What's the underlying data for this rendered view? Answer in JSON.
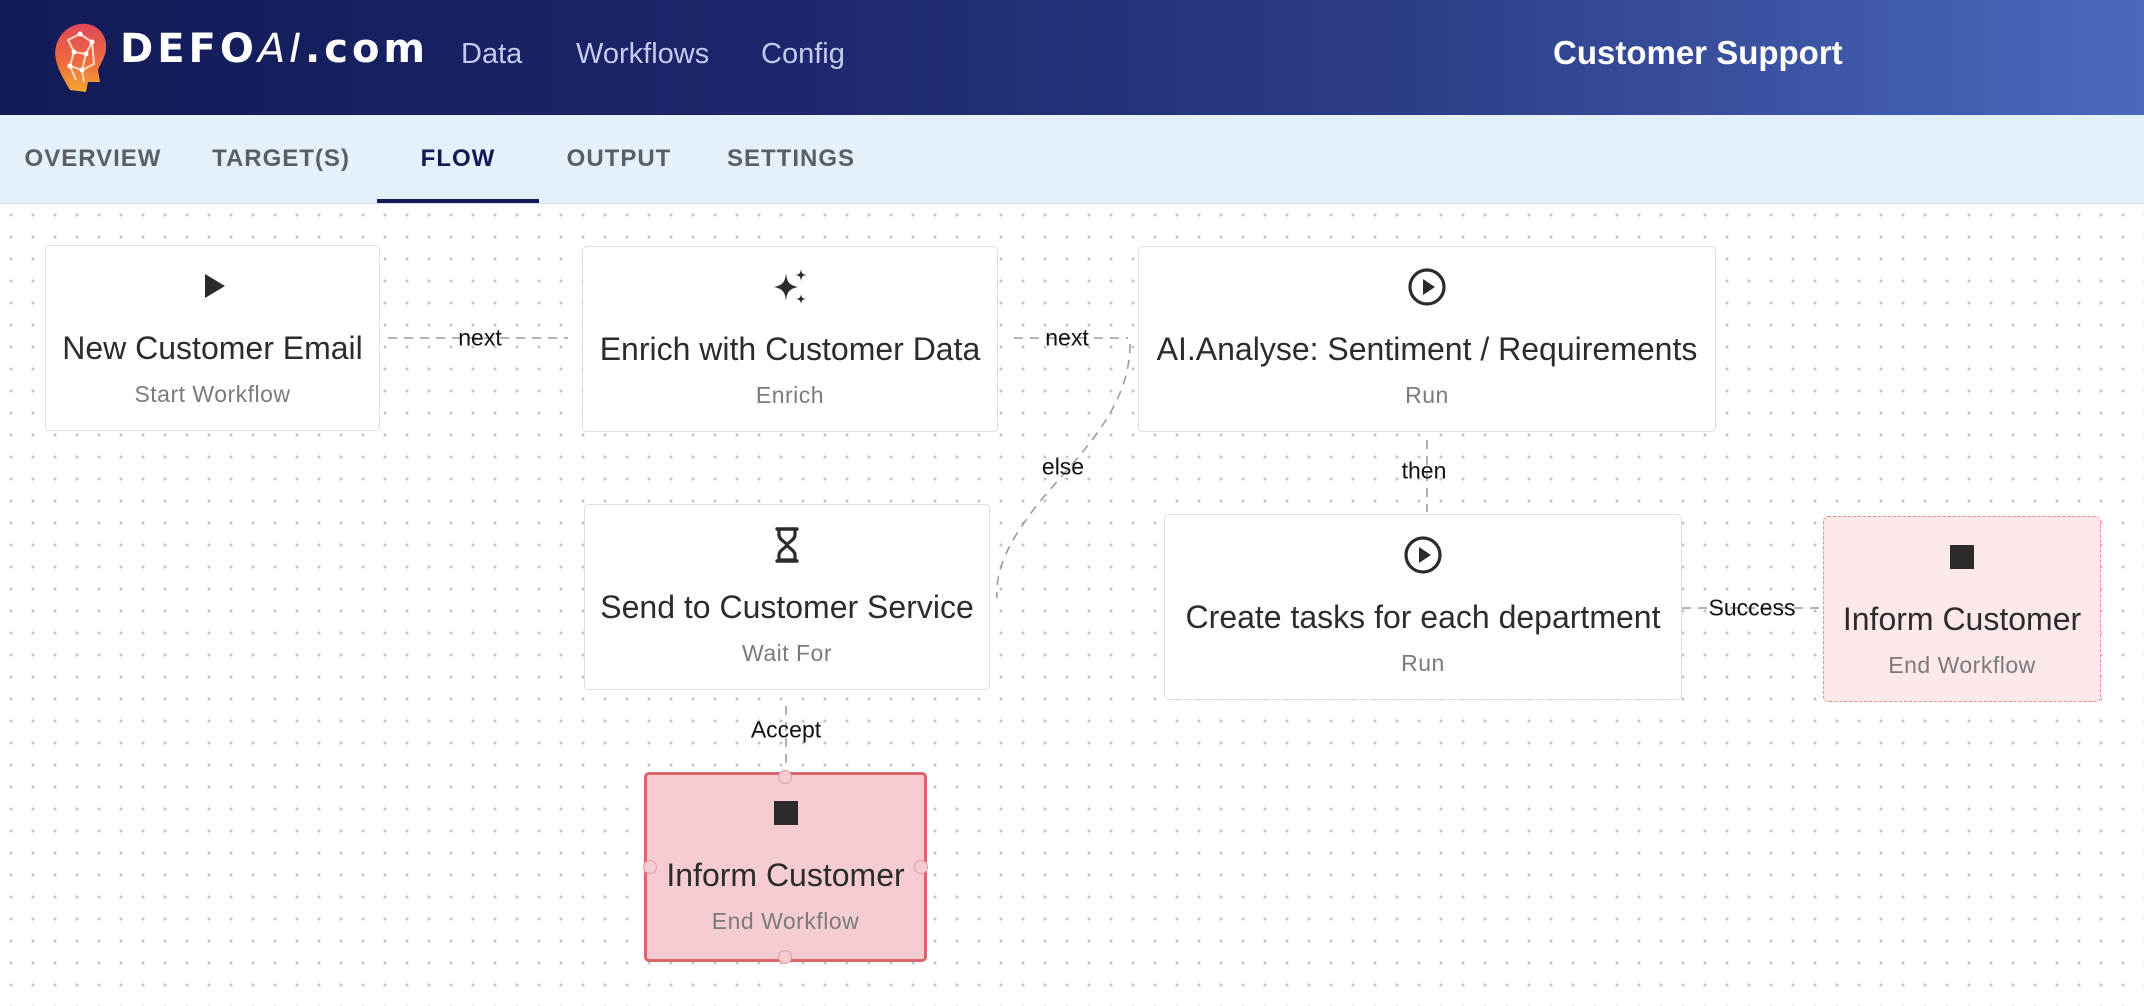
{
  "brand": {
    "logo_main": "DEFO",
    "logo_ai": "AI",
    "logo_suffix": ".com",
    "logo_icon": "brain-head-icon"
  },
  "nav": {
    "items": [
      "Data",
      "Workflows",
      "Config"
    ]
  },
  "app_title": "Customer Support",
  "tabs": {
    "items": [
      "OVERVIEW",
      "TARGET(S)",
      "FLOW",
      "OUTPUT",
      "SETTINGS"
    ],
    "active": "FLOW"
  },
  "flow": {
    "nodes": {
      "start": {
        "title": "New Customer Email",
        "subtitle": "Start Workflow",
        "icon": "play-icon"
      },
      "enrich": {
        "title": "Enrich with Customer Data",
        "subtitle": "Enrich",
        "icon": "sparkles-icon"
      },
      "analyse": {
        "title": "AI.Analyse: Sentiment / Requirements",
        "subtitle": "Run",
        "icon": "play-circle-icon"
      },
      "wait": {
        "title": "Send to Customer Service",
        "subtitle": "Wait For",
        "icon": "hourglass-icon"
      },
      "tasks": {
        "title": "Create tasks for each department",
        "subtitle": "Run",
        "icon": "play-circle-icon"
      },
      "inform_right": {
        "title": "Inform Customer",
        "subtitle": "End Workflow",
        "icon": "stop-square-icon"
      },
      "inform_bottom": {
        "title": "Inform Customer",
        "subtitle": "End Workflow",
        "icon": "stop-square-icon"
      }
    },
    "edge_labels": {
      "start_enrich": "next",
      "enrich_analyse": "next",
      "analyse_wait": "else",
      "analyse_tasks": "then",
      "tasks_inform": "Success",
      "wait_inform": "Accept"
    }
  },
  "colors": {
    "header_start": "#121a56",
    "header_end": "#4a69be",
    "tab_bar": "#e5f1fa",
    "tab_active": "#101a55",
    "end_node_fill": "#f5ccd2",
    "end_node_border": "#d9666c",
    "end_node_light": "#fde8ea"
  }
}
